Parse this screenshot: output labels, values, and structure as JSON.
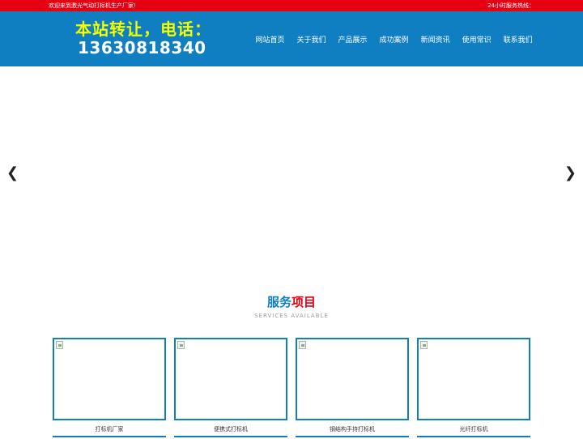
{
  "topbar": {
    "welcome": "欢迎来到激光气动打标机生产厂家!",
    "hotline": "24小时服务热线："
  },
  "header": {
    "logo_line1": "本站转让，电话：",
    "logo_line2": "13630818340"
  },
  "nav": {
    "items": [
      {
        "label": "网站首页"
      },
      {
        "label": "关于我们"
      },
      {
        "label": "产品展示"
      },
      {
        "label": "成功案例"
      },
      {
        "label": "新闻资讯"
      },
      {
        "label": "使用常识"
      },
      {
        "label": "联系我们"
      }
    ]
  },
  "banner": {
    "prev": "❮",
    "next": "❯"
  },
  "services": {
    "title_part1": "服务",
    "title_part2": "项目",
    "subtitle": "SERVICES AVAILABLE",
    "cards": [
      {
        "caption": "打标机厂家"
      },
      {
        "caption": "便携式打标机"
      },
      {
        "caption": "钢结构手持打标机"
      },
      {
        "caption": "光纤打标机"
      }
    ]
  },
  "colors": {
    "topbar": "#e50012",
    "header": "#0f7fc1",
    "logo": "#f4ff00",
    "accent_blue": "#0f7fc1",
    "accent_red": "#e50012"
  }
}
